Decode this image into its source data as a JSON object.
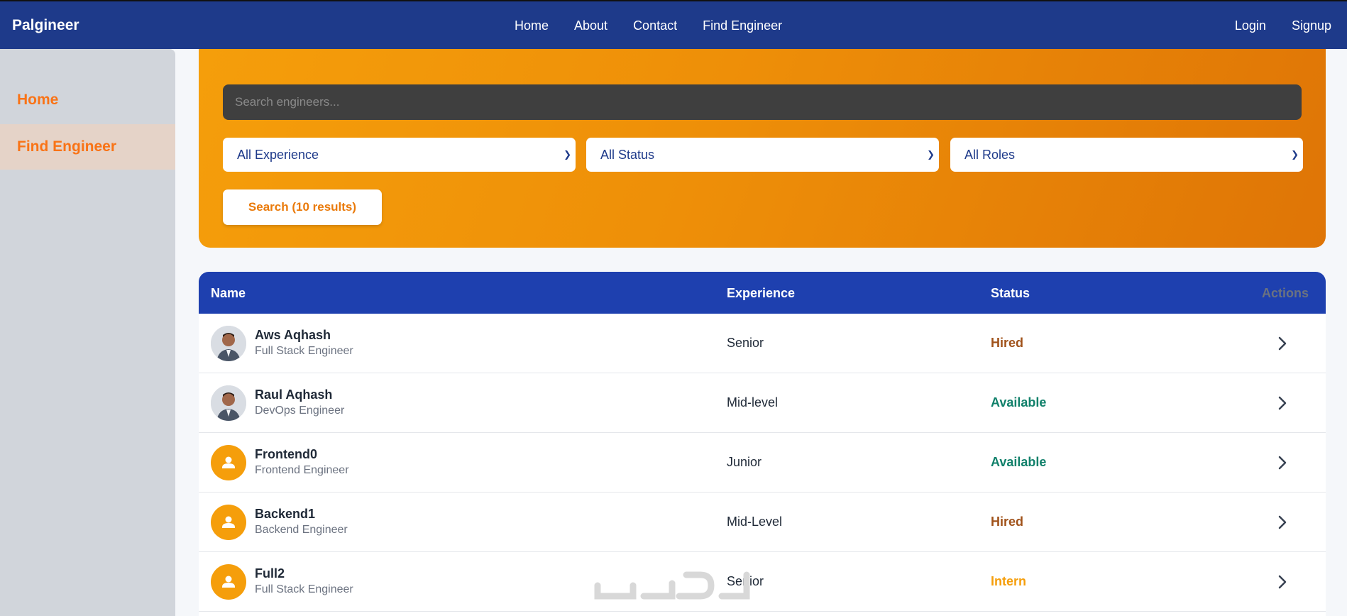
{
  "header": {
    "brand": "Palgineer",
    "nav": [
      "Home",
      "About",
      "Contact",
      "Find Engineer"
    ],
    "auth": [
      "Login",
      "Signup"
    ]
  },
  "sidebar": {
    "items": [
      {
        "label": "Home",
        "active": false
      },
      {
        "label": "Find Engineer",
        "active": true
      }
    ]
  },
  "search": {
    "placeholder": "Search engineers...",
    "filters": {
      "experience": "All Experience",
      "status": "All Status",
      "roles": "All Roles"
    },
    "button_label": "Search (10 results)"
  },
  "table": {
    "columns": [
      "Name",
      "Experience",
      "Status",
      "Actions"
    ],
    "rows": [
      {
        "name": "Aws Aqhash",
        "role": "Full Stack Engineer",
        "experience": "Senior",
        "status": "Hired",
        "avatar": "photo"
      },
      {
        "name": "Raul Aqhash",
        "role": "DevOps Engineer",
        "experience": "Mid-level",
        "status": "Available",
        "avatar": "photo"
      },
      {
        "name": "Frontend0",
        "role": "Frontend Engineer",
        "experience": "Junior",
        "status": "Available",
        "avatar": "user-icon"
      },
      {
        "name": "Backend1",
        "role": "Backend Engineer",
        "experience": "Mid-Level",
        "status": "Hired",
        "avatar": "user-icon"
      },
      {
        "name": "Full2",
        "role": "Full Stack Engineer",
        "experience": "Senior",
        "status": "Intern",
        "avatar": "user-icon"
      }
    ]
  },
  "colors": {
    "nav_bg": "#1e3a8a",
    "table_header": "#1e40af",
    "accent_orange": "#f59e0b",
    "status_hired": "#a0521a",
    "status_available": "#10806a",
    "status_intern": "#f59e0b"
  }
}
